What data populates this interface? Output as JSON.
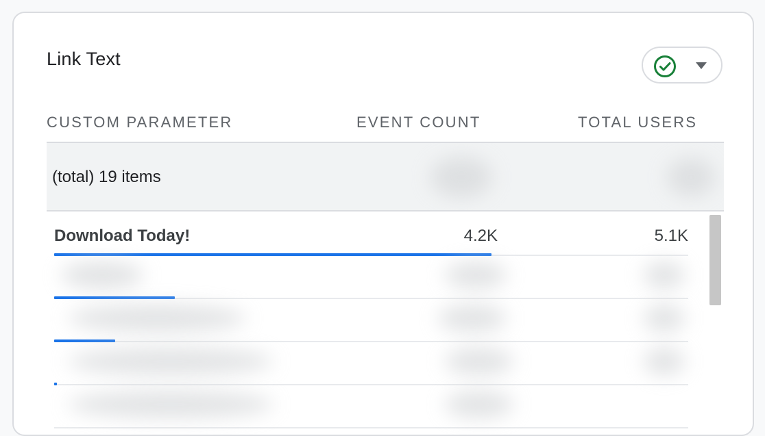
{
  "card": {
    "title": "Link Text",
    "status_icon": "check-circle-icon",
    "status_color": "#188038",
    "dropdown_icon": "caret-down-icon"
  },
  "table": {
    "columns": [
      "CUSTOM PARAMETER",
      "EVENT COUNT",
      "TOTAL USERS"
    ],
    "total_label": "(total) 19 items",
    "rows": [
      {
        "label": "Download Today!",
        "event_count": "4.2K",
        "total_users": "5.1K",
        "share": 0.69
      },
      {
        "label": "",
        "event_count": "",
        "total_users": "",
        "share": 0.19
      },
      {
        "label": "",
        "event_count": "",
        "total_users": "",
        "share": 0.096
      },
      {
        "label": "",
        "event_count": "",
        "total_users": "",
        "share": 0.004
      }
    ]
  },
  "colors": {
    "bar": "#1a73e8",
    "header_text": "#5f6368",
    "total_row_bg": "#f1f3f4"
  }
}
